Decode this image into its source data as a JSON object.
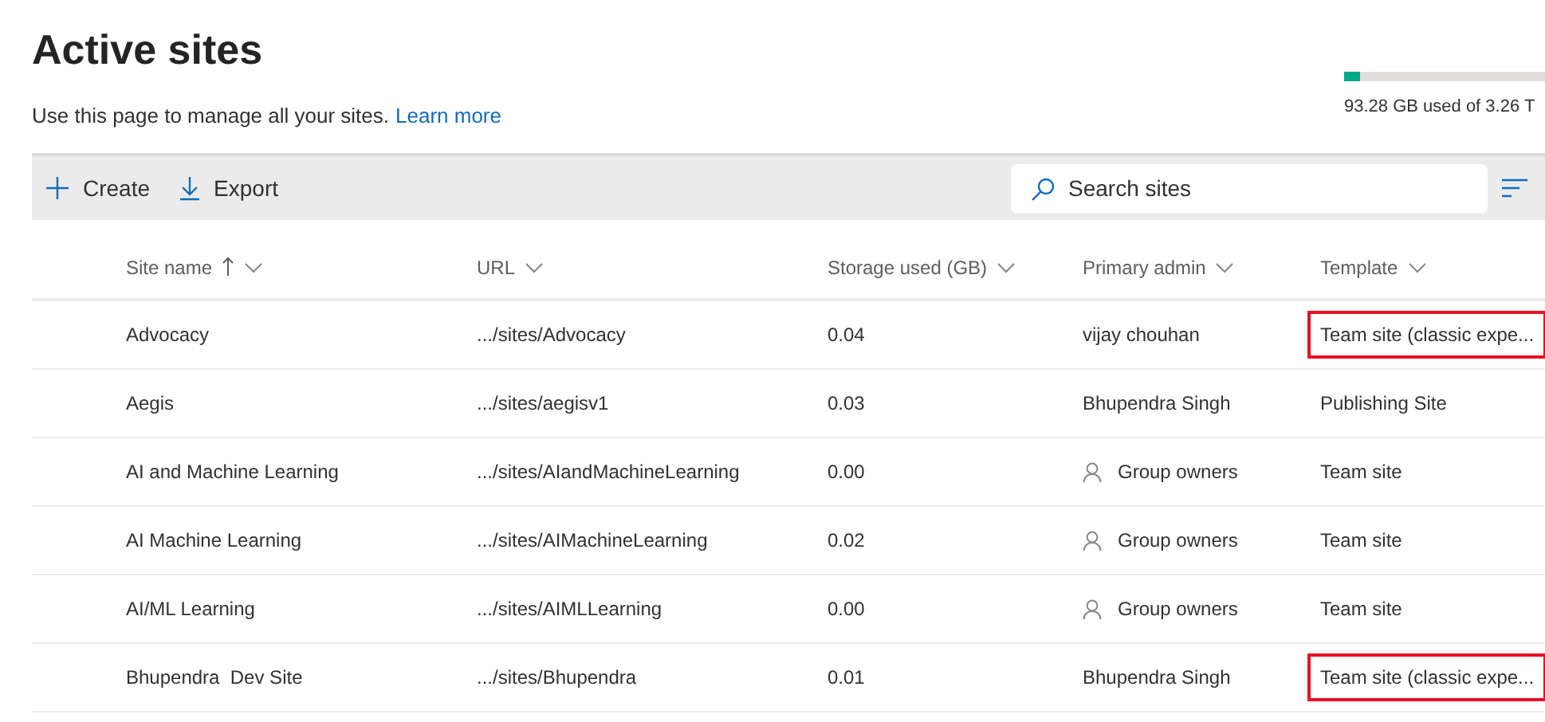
{
  "header": {
    "title": "Active sites",
    "description": "Use this page to manage all your sites.",
    "learn_more": "Learn more"
  },
  "storage": {
    "level": 0.08,
    "text": "93.28 GB used of 3.26 T"
  },
  "toolbar": {
    "actions": [
      {
        "kind": "create",
        "label": "Create"
      },
      {
        "kind": "export",
        "label": "Export"
      }
    ],
    "search": {
      "placeholder": "Search sites"
    }
  },
  "table": {
    "columns": [
      {
        "label": "Site name",
        "sorted": true
      },
      {
        "label": "URL",
        "sorted": false
      },
      {
        "label": "Storage used (GB)",
        "sorted": false
      },
      {
        "label": "Primary admin",
        "sorted": false
      },
      {
        "label": "Template",
        "sorted": false
      }
    ],
    "rows": [
      {
        "site_name": "Advocacy",
        "url": ".../sites/Advocacy",
        "storage": "0.04",
        "admin": {
          "kind": "user",
          "name": "vijay chouhan"
        },
        "template": "Team site (classic expe...",
        "highlighted": true
      },
      {
        "site_name": "Aegis",
        "url": ".../sites/aegisv1",
        "storage": "0.03",
        "admin": {
          "kind": "user",
          "name": "Bhupendra Singh"
        },
        "template": "Publishing Site",
        "highlighted": false
      },
      {
        "site_name": "AI and Machine Learning",
        "url": ".../sites/AIandMachineLearning",
        "storage": "0.00",
        "admin": {
          "kind": "group",
          "name": "Group owners"
        },
        "template": "Team site",
        "highlighted": false
      },
      {
        "site_name": "AI Machine Learning",
        "url": ".../sites/AIMachineLearning",
        "storage": "0.02",
        "admin": {
          "kind": "group",
          "name": "Group owners"
        },
        "template": "Team site",
        "highlighted": false
      },
      {
        "site_name": "AI/ML Learning",
        "url": ".../sites/AIMLLearning",
        "storage": "0.00",
        "admin": {
          "kind": "group",
          "name": "Group owners"
        },
        "template": "Team site",
        "highlighted": false
      },
      {
        "site_name": "Bhupendra  Dev Site",
        "url": ".../sites/Bhupendra",
        "storage": "0.01",
        "admin": {
          "kind": "user",
          "name": "Bhupendra Singh"
        },
        "template": "Team site (classic expe...",
        "highlighted": true
      }
    ]
  }
}
